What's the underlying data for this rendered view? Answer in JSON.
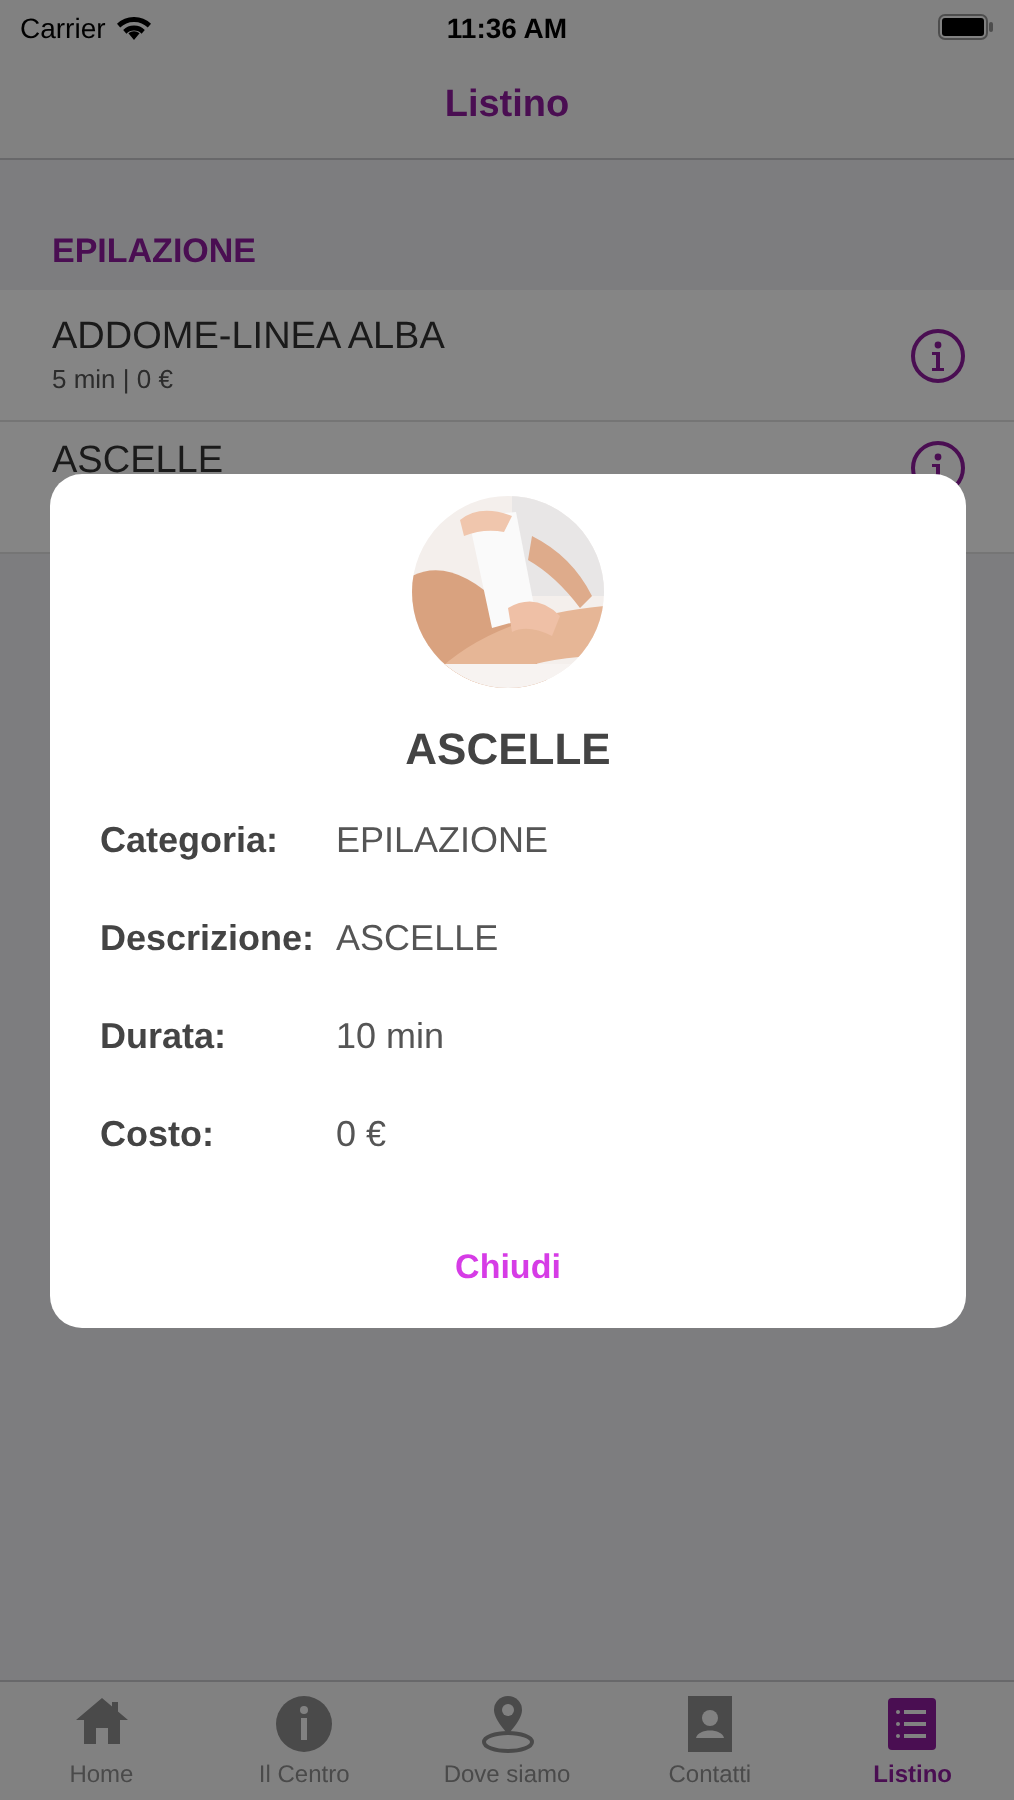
{
  "status_bar": {
    "carrier": "Carrier",
    "time": "11:36 AM"
  },
  "nav_bar": {
    "title": "Listino"
  },
  "sections": [
    {
      "header": "EPILAZIONE",
      "items": [
        {
          "name": "ADDOME-LINEA ALBA",
          "detail": "5 min | 0 €"
        },
        {
          "name": "ASCELLE"
        }
      ]
    }
  ],
  "dialog": {
    "title": "ASCELLE",
    "fields": [
      {
        "label": "Categoria:",
        "value": "EPILAZIONE"
      },
      {
        "label": "Descrizione:",
        "value": "ASCELLE"
      },
      {
        "label": "Durata:",
        "value": "10 min"
      },
      {
        "label": "Costo:",
        "value": "0 €"
      }
    ],
    "button": "Chiudi"
  },
  "tab_bar": [
    {
      "label": "Home",
      "kind": "home",
      "selected": false
    },
    {
      "label": "Il Centro",
      "kind": "info",
      "selected": false
    },
    {
      "label": "Dove siamo",
      "kind": "pin",
      "selected": false
    },
    {
      "label": "Contatti",
      "kind": "contact",
      "selected": false
    },
    {
      "label": "Listino",
      "kind": "list",
      "selected": true
    }
  ]
}
